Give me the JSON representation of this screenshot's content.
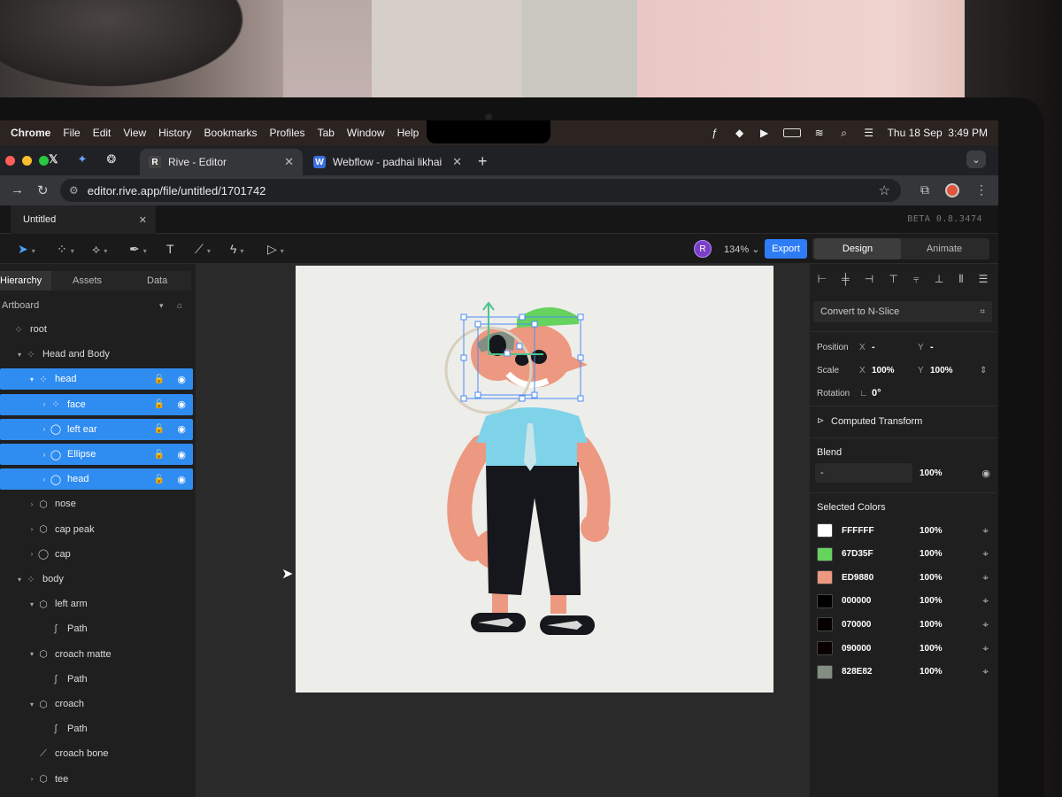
{
  "menubar": {
    "app": "Chrome",
    "items": [
      "File",
      "Edit",
      "View",
      "History",
      "Bookmarks",
      "Profiles",
      "Tab",
      "Window",
      "Help"
    ],
    "clock": "Thu 18 Sep  3:49 PM"
  },
  "browser": {
    "tabs": [
      {
        "title": "Rive - Editor",
        "favicon": "R",
        "active": true
      },
      {
        "title": "Webflow - padhai likhai",
        "favicon": "W",
        "active": false
      }
    ],
    "url": "editor.rive.app/file/untitled/1701742"
  },
  "rive": {
    "file_tab": "Untitled",
    "version": "BETA 0.8.3474",
    "user_initial": "R",
    "zoom": "134%",
    "export_label": "Export",
    "mode_design": "Design",
    "mode_animate": "Animate",
    "left_tabs": [
      "Hierarchy",
      "Assets",
      "Data"
    ],
    "artboard_label": "Artboard",
    "tree": [
      {
        "label": "root",
        "indent": 0,
        "icon": "node",
        "chev": "",
        "sel": false
      },
      {
        "label": "Head and Body",
        "indent": 1,
        "icon": "node",
        "chev": "v",
        "sel": false
      },
      {
        "label": "head",
        "indent": 2,
        "icon": "node",
        "chev": "v",
        "sel": true
      },
      {
        "label": "face",
        "indent": 3,
        "icon": "node",
        "chev": ">",
        "sel": true
      },
      {
        "label": "left ear",
        "indent": 3,
        "icon": "ellipse",
        "chev": ">",
        "sel": true
      },
      {
        "label": "Ellipse",
        "indent": 3,
        "icon": "ellipse",
        "chev": ">",
        "sel": true
      },
      {
        "label": "head",
        "indent": 3,
        "icon": "ellipse",
        "chev": ">",
        "sel": true
      },
      {
        "label": "nose",
        "indent": 2,
        "icon": "shape",
        "chev": ">",
        "sel": false
      },
      {
        "label": "cap peak",
        "indent": 2,
        "icon": "shape",
        "chev": ">",
        "sel": false
      },
      {
        "label": "cap",
        "indent": 2,
        "icon": "ellipse",
        "chev": ">",
        "sel": false
      },
      {
        "label": "body",
        "indent": 1,
        "icon": "node",
        "chev": "v",
        "sel": false
      },
      {
        "label": "left arm",
        "indent": 2,
        "icon": "shape",
        "chev": "v",
        "sel": false
      },
      {
        "label": "Path",
        "indent": 3,
        "icon": "path",
        "chev": "",
        "sel": false
      },
      {
        "label": "croach matte",
        "indent": 2,
        "icon": "shape",
        "chev": "v",
        "sel": false
      },
      {
        "label": "Path",
        "indent": 3,
        "icon": "path",
        "chev": "",
        "sel": false
      },
      {
        "label": "croach",
        "indent": 2,
        "icon": "shape",
        "chev": "v",
        "sel": false
      },
      {
        "label": "Path",
        "indent": 3,
        "icon": "path",
        "chev": "",
        "sel": false
      },
      {
        "label": "croach bone",
        "indent": 2,
        "icon": "bone",
        "chev": "",
        "sel": false
      },
      {
        "label": "tee",
        "indent": 2,
        "icon": "shape",
        "chev": ">",
        "sel": false
      }
    ],
    "inspector": {
      "nslice": "Convert to N-Slice",
      "position_label": "Position",
      "position_x": "-",
      "position_y": "-",
      "scale_label": "Scale",
      "scale_x": "100%",
      "scale_y": "100%",
      "rotation_label": "Rotation",
      "rotation": "0°",
      "computed": "Computed Transform",
      "blend_label": "Blend",
      "blend_mode": "-",
      "blend_opacity": "100%",
      "selected_colors_label": "Selected Colors",
      "colors": [
        {
          "hex": "FFFFFF",
          "pct": "100%",
          "color": "#FFFFFF"
        },
        {
          "hex": "67D35F",
          "pct": "100%",
          "color": "#67D35F"
        },
        {
          "hex": "ED9880",
          "pct": "100%",
          "color": "#ED9880"
        },
        {
          "hex": "000000",
          "pct": "100%",
          "color": "#000000"
        },
        {
          "hex": "070000",
          "pct": "100%",
          "color": "#070000"
        },
        {
          "hex": "090000",
          "pct": "100%",
          "color": "#090000"
        },
        {
          "hex": "828E82",
          "pct": "100%",
          "color": "#828E82"
        }
      ]
    }
  },
  "colors": {
    "accent": "#2F8CF0",
    "export": "#2F7DF6",
    "skin": "#ED9880",
    "cap": "#67D35F",
    "shirt": "#7ED3E8",
    "pants": "#15171C"
  }
}
